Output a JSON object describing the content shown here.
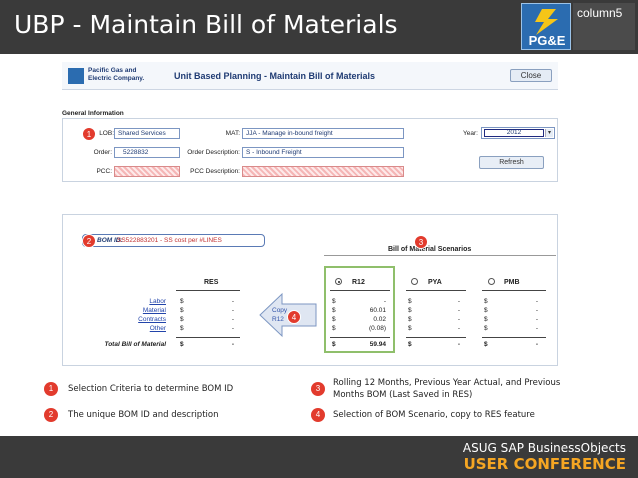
{
  "slide": {
    "title": "UBP - Maintain Bill of Materials",
    "logo_text": "PG&E",
    "partner_logo": "column5"
  },
  "app": {
    "company": "Pacific Gas and Electric Company.",
    "title": "Unit Based Planning - Maintain Bill of Materials",
    "close_label": "Close"
  },
  "general": {
    "section_label": "General Information",
    "lob_label": "LOB:",
    "lob_value": "Shared Services",
    "mat_label": "MAT:",
    "mat_value": "JJA - Manage in-bound freight",
    "year_label": "Year:",
    "year_value": "2012",
    "order_label": "Order:",
    "order_value": "5228832",
    "order_desc_label": "Order Description:",
    "order_desc_value": "S - Inbound Freight",
    "pcc_label": "PCC:",
    "pcc_desc_label": "PCC Description:",
    "refresh_label": "Refresh"
  },
  "bom": {
    "id_label": "BOM ID:",
    "id_value": "SS522883201 - SS cost per #LINES",
    "scenarios_title": "Bill of Material Scenarios",
    "res_header": "RES",
    "scenarios": [
      {
        "label": "R12",
        "selected": true
      },
      {
        "label": "PYA",
        "selected": false
      },
      {
        "label": "PMB",
        "selected": false
      }
    ],
    "copy_label_1": "Copy",
    "copy_label_2": "R12",
    "rows": [
      {
        "label": "Labor",
        "res": "-",
        "r12": "-",
        "pya": "-",
        "pmb": "-"
      },
      {
        "label": "Material",
        "res": "-",
        "r12": "60.01",
        "pya": "-",
        "pmb": "-"
      },
      {
        "label": "Contracts",
        "res": "-",
        "r12": "0.02",
        "pya": "-",
        "pmb": "-"
      },
      {
        "label": "Other",
        "res": "-",
        "r12": "(0.08)",
        "pya": "-",
        "pmb": "-"
      }
    ],
    "total": {
      "label": "Total Bill of Material",
      "res": "-",
      "r12": "59.94",
      "pya": "-",
      "pmb": "-"
    },
    "currency": "$"
  },
  "badges": [
    "1",
    "2",
    "3",
    "4"
  ],
  "legend": [
    {
      "num": "1",
      "text": "Selection Criteria to determine BOM ID"
    },
    {
      "num": "2",
      "text": "The unique BOM ID and description"
    },
    {
      "num": "3",
      "text": "Rolling 12 Months, Previous Year Actual, and Previous Months BOM (Last Saved in RES)"
    },
    {
      "num": "4",
      "text": "Selection of BOM Scenario, copy to RES feature"
    }
  ],
  "footer": {
    "line1": "ASUG SAP BusinessObjects",
    "line2": "USER CONFERENCE"
  },
  "colors": {
    "badge": "#e23b2d",
    "accent": "#f5a623",
    "highlight": "#8fbf6b"
  }
}
